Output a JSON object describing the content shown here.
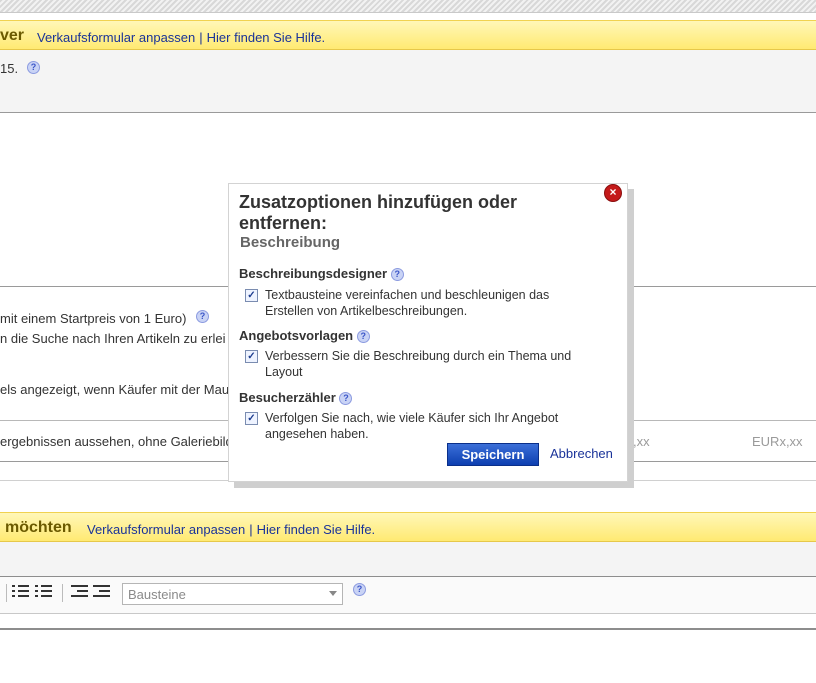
{
  "top_bar": {
    "title_fragment": "ver",
    "links": [
      "Verkaufsformular anpassen",
      "Hier finden Sie Hilfe."
    ]
  },
  "fragments": {
    "line1": "15.",
    "line_startpreis": "mit einem Startpreis von 1 Euro)",
    "line_suche": "n die Suche nach Ihren Artikeln zu erlei",
    "line_angezeigt": "els angezeigt, wenn Käufer mit der Maus",
    "line_ergebnissen": "ergebnissen aussehen, ohne Galeriebild",
    "price_a": ",xx",
    "price_b": "EURx,xx"
  },
  "bottom_bar": {
    "title_fragment": "möchten",
    "links": [
      "Verkaufsformular anpassen",
      "Hier finden Sie Hilfe."
    ]
  },
  "editor_toolbar": {
    "select_value": "Bausteine"
  },
  "dialog": {
    "title": "Zusatzoptionen hinzufügen oder entfernen:",
    "subtitle": "Beschreibung",
    "sections": [
      {
        "heading": "Beschreibungsdesigner",
        "option": "Textbausteine vereinfachen und beschleunigen das Erstellen von Artikelbeschreibungen.",
        "checked": true
      },
      {
        "heading": "Angebotsvorlagen",
        "option": "Verbessern Sie die Beschreibung durch ein Thema und Layout",
        "checked": true
      },
      {
        "heading": "Besucherzähler",
        "option": "Verfolgen Sie nach, wie viele Käufer sich Ihr Angebot angesehen haben.",
        "checked": true
      }
    ],
    "save_label": "Speichern",
    "cancel_label": "Abbrechen"
  }
}
